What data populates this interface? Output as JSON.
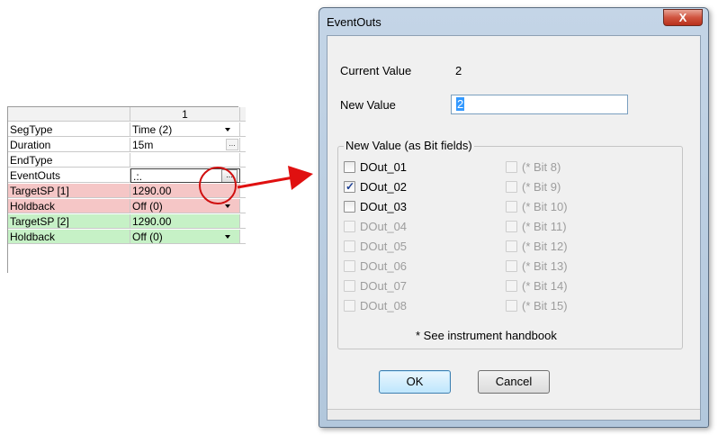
{
  "grid": {
    "column_header": "1",
    "rows": [
      {
        "label": "SegType",
        "value": "Time (2)",
        "kind": "dropdown",
        "tint": "none"
      },
      {
        "label": "Duration",
        "value": "15m",
        "kind": "ellipsis",
        "tint": "none"
      },
      {
        "label": "EndType",
        "value": "",
        "kind": "plain",
        "tint": "none"
      },
      {
        "label": "EventOuts",
        "value": ".:.",
        "kind": "editor",
        "tint": "none"
      },
      {
        "label": "TargetSP [1]",
        "value": "1290.00",
        "kind": "plain",
        "tint": "red"
      },
      {
        "label": "Holdback",
        "value": "Off (0)",
        "kind": "dropdown",
        "tint": "red"
      },
      {
        "label": "TargetSP [2]",
        "value": "1290.00",
        "kind": "plain",
        "tint": "green"
      },
      {
        "label": "Holdback",
        "value": "Off (0)",
        "kind": "dropdown",
        "tint": "green"
      }
    ],
    "ellipsis": "..."
  },
  "dialog": {
    "title": "EventOuts",
    "close_glyph": "X",
    "current_value_label": "Current Value",
    "current_value": "2",
    "new_value_label": "New Value",
    "new_value_input": "2",
    "group_title": "New Value (as Bit fields)",
    "bits_left": [
      {
        "label": "DOut_01",
        "checked": false,
        "enabled": true
      },
      {
        "label": "DOut_02",
        "checked": true,
        "enabled": true
      },
      {
        "label": "DOut_03",
        "checked": false,
        "enabled": true
      },
      {
        "label": "DOut_04",
        "checked": false,
        "enabled": false
      },
      {
        "label": "DOut_05",
        "checked": false,
        "enabled": false
      },
      {
        "label": "DOut_06",
        "checked": false,
        "enabled": false
      },
      {
        "label": "DOut_07",
        "checked": false,
        "enabled": false
      },
      {
        "label": "DOut_08",
        "checked": false,
        "enabled": false
      }
    ],
    "bits_right": [
      {
        "label": "(* Bit 8)",
        "checked": false,
        "enabled": false
      },
      {
        "label": "(* Bit 9)",
        "checked": false,
        "enabled": false
      },
      {
        "label": "(* Bit 10)",
        "checked": false,
        "enabled": false
      },
      {
        "label": "(* Bit 11)",
        "checked": false,
        "enabled": false
      },
      {
        "label": "(* Bit 12)",
        "checked": false,
        "enabled": false
      },
      {
        "label": "(* Bit 13)",
        "checked": false,
        "enabled": false
      },
      {
        "label": "(* Bit 14)",
        "checked": false,
        "enabled": false
      },
      {
        "label": "(* Bit 15)",
        "checked": false,
        "enabled": false
      }
    ],
    "note": "* See instrument handbook",
    "ok_label": "OK",
    "cancel_label": "Cancel"
  },
  "colors": {
    "highlight_circle": "#d01010",
    "arrow": "#e01010",
    "row_red": "#f5c6c6",
    "row_green": "#c6f1c6"
  }
}
